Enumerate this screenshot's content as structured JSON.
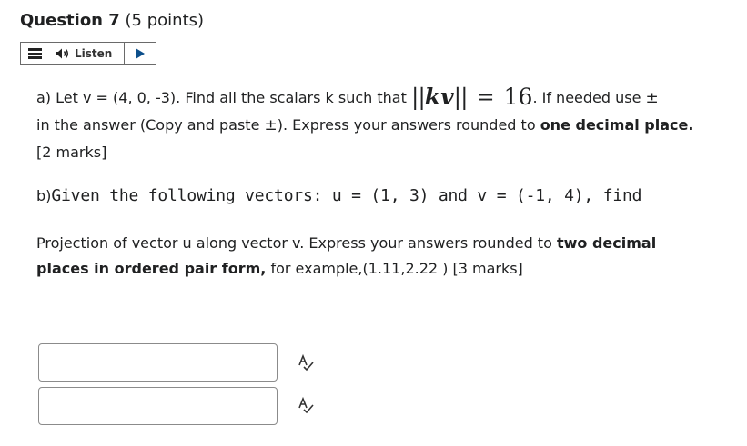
{
  "question": {
    "label": "Question 7",
    "points": "(5 points)"
  },
  "listen_bar": {
    "listen_label": "Listen"
  },
  "part_a": {
    "prefix": "a) Let v = (4, 0, -3). Find all the scalars k such that ",
    "math_bars_open": "||",
    "math_var": "kv",
    "math_bars_close": "||",
    "math_eq": "=",
    "math_value": "16",
    "after_math": ". If needed use ",
    "pm_symbol": "±",
    "line2_a": " in the answer (Copy and paste ",
    "pm_symbol_2": "±",
    "line2_b": ").  Express your answers rounded to ",
    "bold_1": "one decimal place.",
    "marks": "  [2 marks]"
  },
  "part_b": {
    "label": "b)",
    "text": "Given the following vectors: u = (1, 3) and v = (-1, 4), find"
  },
  "projection": {
    "text_1": "Projection of vector u along vector v. Express your answers rounded to ",
    "bold_1": "two decimal places in ordered pair form,",
    "text_2": " for example,(1.11,2.22 )   [3 marks]"
  },
  "answers": [
    {
      "value": ""
    },
    {
      "value": ""
    }
  ],
  "icons": {
    "menu": "menu-icon",
    "speaker": "speaker-icon",
    "play": "play-icon",
    "spell_check": "spell-check-icon"
  },
  "colors": {
    "play_blue": "#0d4f8b",
    "border": "#8b8b8b"
  }
}
